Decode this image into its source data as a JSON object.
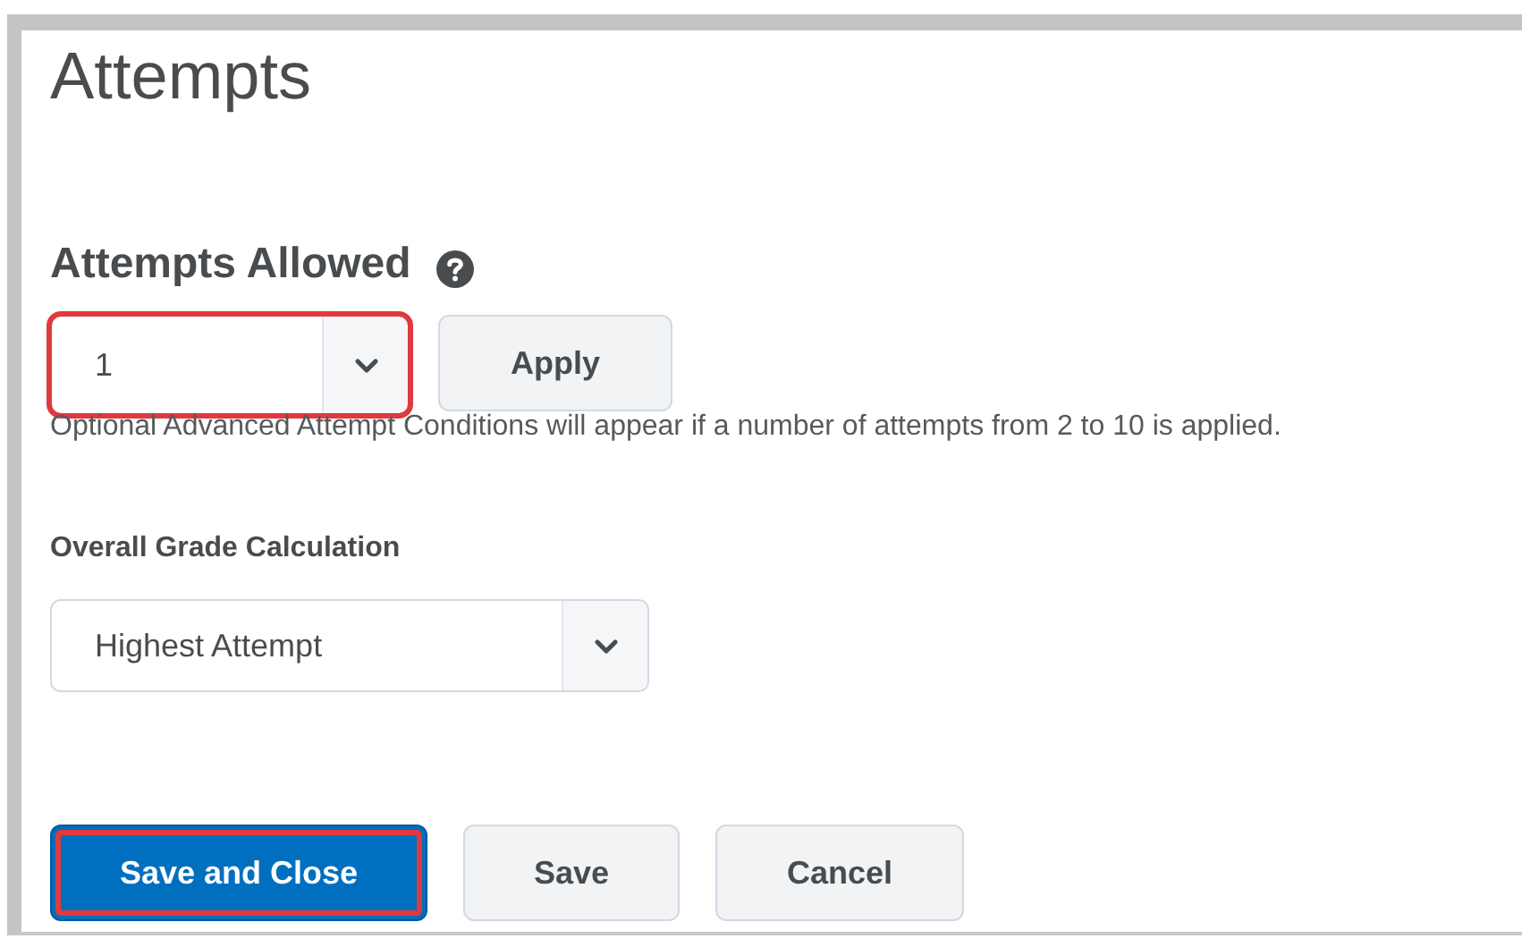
{
  "title": "Attempts",
  "attempts_allowed": {
    "label": "Attempts Allowed",
    "select": {
      "value": "1",
      "highlighted": true
    },
    "apply_button": "Apply",
    "hint": "Optional Advanced Attempt Conditions will appear if a number of attempts from 2 to 10 is applied."
  },
  "overall_grade": {
    "label": "Overall Grade Calculation",
    "select": {
      "value": "Highest Attempt",
      "highlighted": false
    }
  },
  "buttons": [
    {
      "label": "Save and Close",
      "kind": "primary",
      "highlighted": true
    },
    {
      "label": "Save",
      "kind": "secondary",
      "highlighted": false
    },
    {
      "label": "Cancel",
      "kind": "secondary",
      "highlighted": false
    }
  ]
}
